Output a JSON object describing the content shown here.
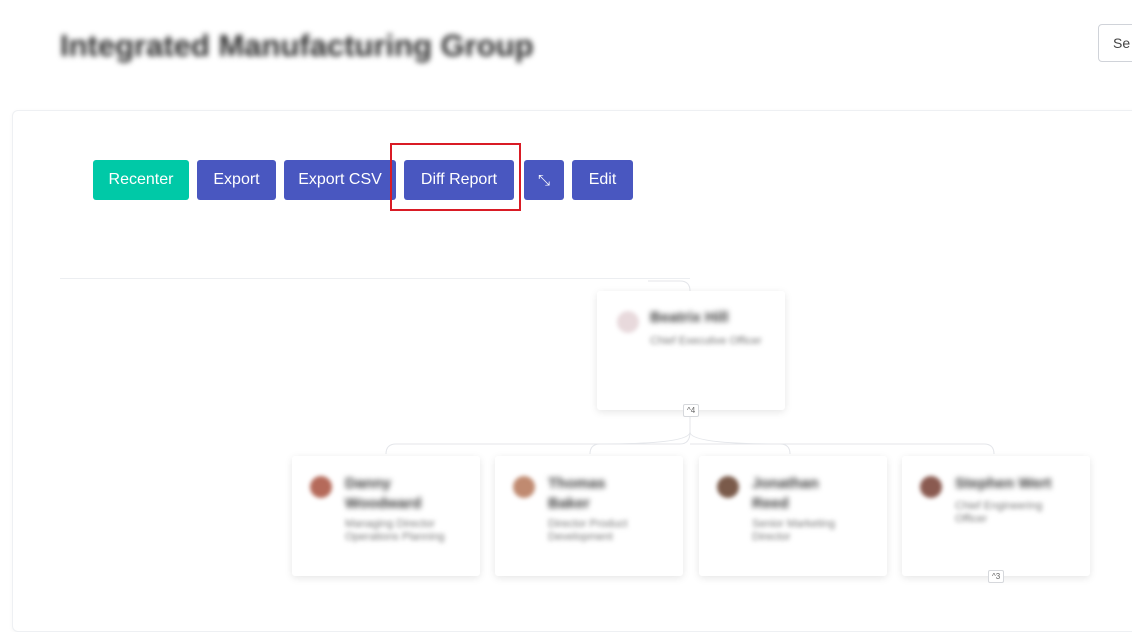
{
  "header": {
    "title": "Integrated Manufacturing Group",
    "search_label": "Se"
  },
  "toolbar": {
    "recenter_label": "Recenter",
    "export_label": "Export",
    "export_csv_label": "Export CSV",
    "diff_report_label": "Diff Report",
    "fullscreen_icon": "arrows-collapse-icon",
    "fullscreen_glyph": "⤡",
    "edit_label": "Edit"
  },
  "colors": {
    "primary": "#4957c0",
    "accent": "#00c9a7",
    "highlight": "#d91b25"
  },
  "org": {
    "root": {
      "name": "Beatrix Hill",
      "role": "Chief Executive Officer",
      "children_count": "^4"
    },
    "children": [
      {
        "name": "Danny Woodward",
        "role": "Managing Director Operations Planning"
      },
      {
        "name": "Thomas Baker",
        "role": "Director Product Development"
      },
      {
        "name": "Jonathan Reed",
        "role": "Senior Marketing Director"
      },
      {
        "name": "Stephen Wert",
        "role": "Chief Engineering Officer",
        "children_count": "^3"
      }
    ]
  }
}
